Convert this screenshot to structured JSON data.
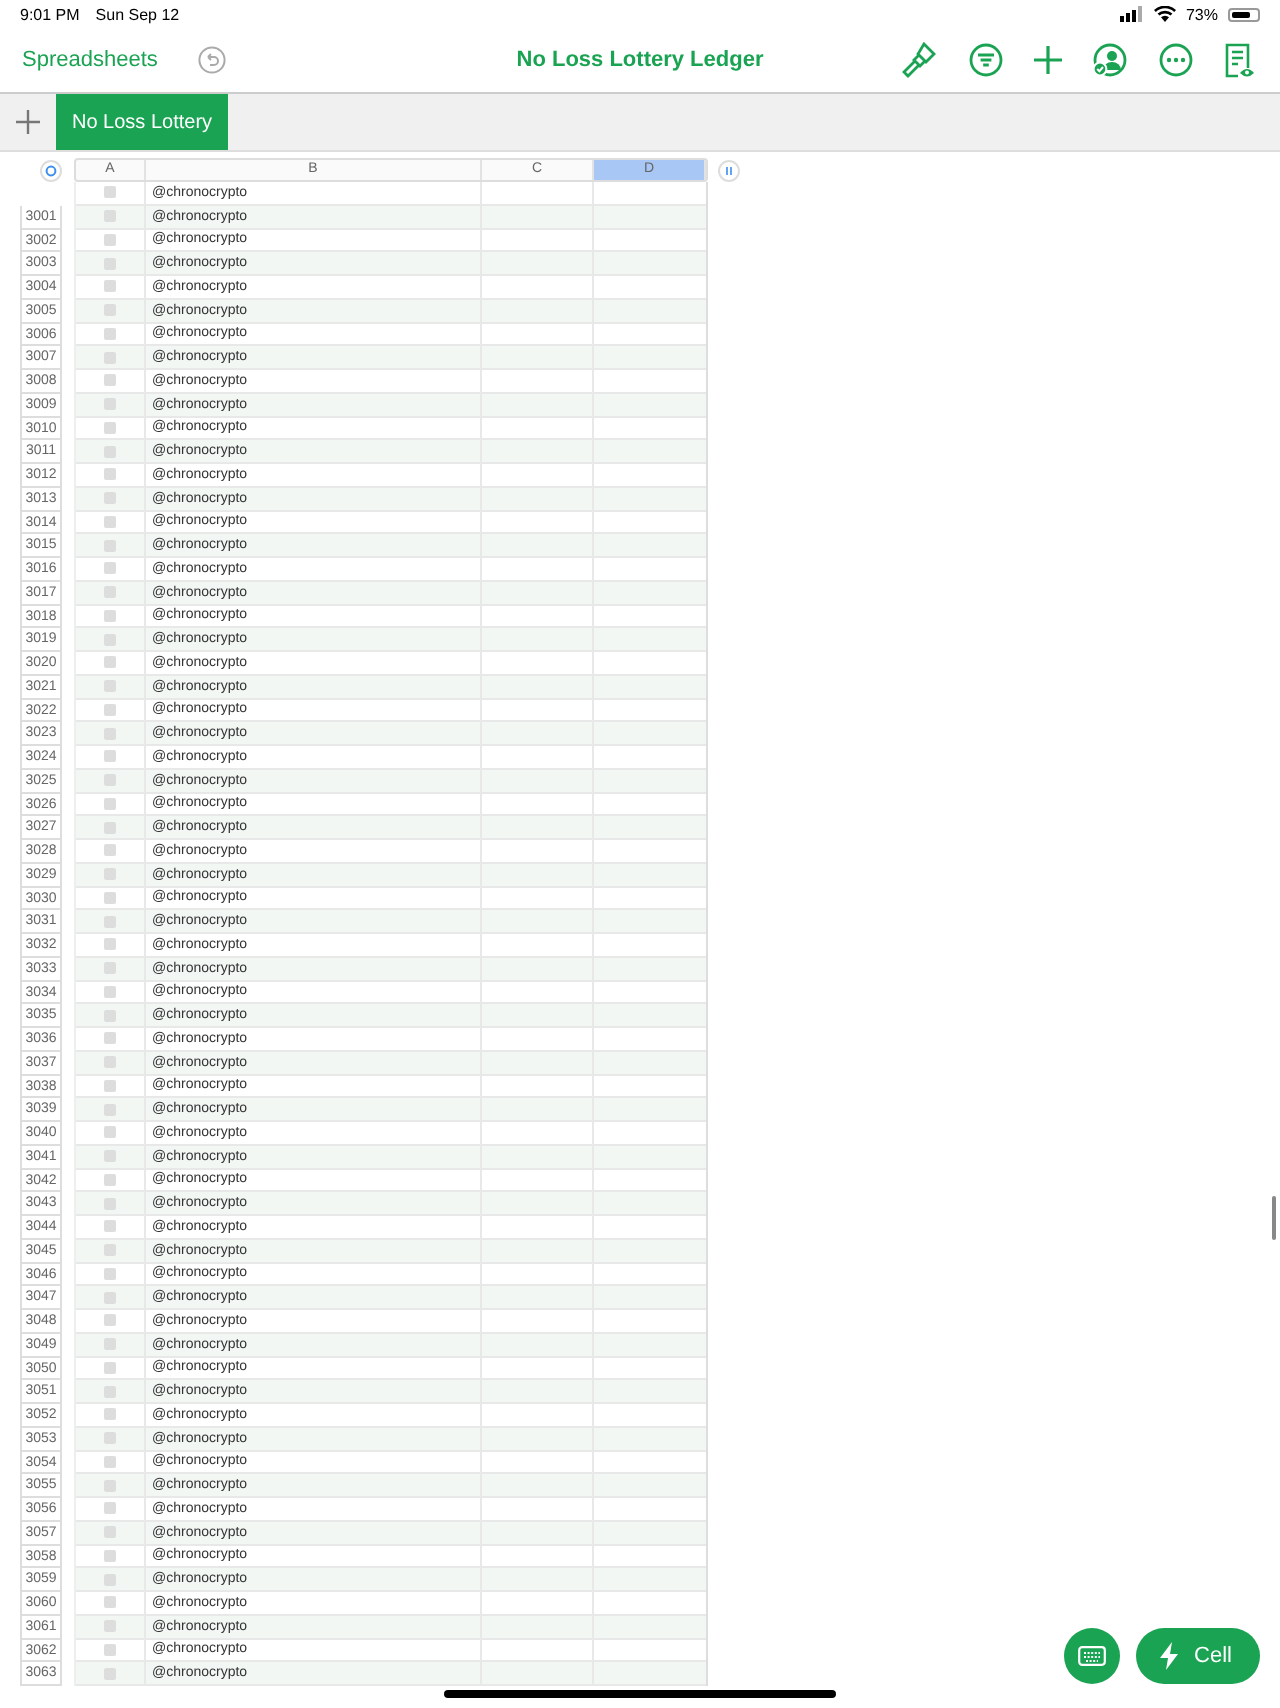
{
  "status_bar": {
    "time": "9:01 PM",
    "date": "Sun Sep 12",
    "battery": "73%"
  },
  "toolbar": {
    "back": "Spreadsheets",
    "title": "No Loss Lottery Ledger"
  },
  "sheet_tabs": [
    {
      "label": "No Loss Lottery",
      "selected": true
    }
  ],
  "table": {
    "columns": [
      {
        "label": "A",
        "selected": false
      },
      {
        "label": "B",
        "selected": false
      },
      {
        "label": "C",
        "selected": false
      },
      {
        "label": "D",
        "selected": true
      }
    ],
    "rows": [
      {
        "b": "@chronocrypto",
        "checked": false
      },
      {
        "number": "3001",
        "b": "@chronocrypto",
        "checked": false
      },
      {
        "number": "3002",
        "b": "@chronocrypto",
        "checked": false
      },
      {
        "number": "3003",
        "b": "@chronocrypto",
        "checked": false
      },
      {
        "number": "3004",
        "b": "@chronocrypto",
        "checked": false
      },
      {
        "number": "3005",
        "b": "@chronocrypto",
        "checked": false
      },
      {
        "number": "3006",
        "b": "@chronocrypto",
        "checked": false
      },
      {
        "number": "3007",
        "b": "@chronocrypto",
        "checked": false
      },
      {
        "number": "3008",
        "b": "@chronocrypto",
        "checked": false
      },
      {
        "number": "3009",
        "b": "@chronocrypto",
        "checked": false
      },
      {
        "number": "3010",
        "b": "@chronocrypto",
        "checked": false
      },
      {
        "number": "3011",
        "b": "@chronocrypto",
        "checked": false
      },
      {
        "number": "3012",
        "b": "@chronocrypto",
        "checked": false
      },
      {
        "number": "3013",
        "b": "@chronocrypto",
        "checked": false
      },
      {
        "number": "3014",
        "b": "@chronocrypto",
        "checked": false
      },
      {
        "number": "3015",
        "b": "@chronocrypto",
        "checked": false
      },
      {
        "number": "3016",
        "b": "@chronocrypto",
        "checked": false
      },
      {
        "number": "3017",
        "b": "@chronocrypto",
        "checked": false
      },
      {
        "number": "3018",
        "b": "@chronocrypto",
        "checked": false
      },
      {
        "number": "3019",
        "b": "@chronocrypto",
        "checked": false
      },
      {
        "number": "3020",
        "b": "@chronocrypto",
        "checked": false
      },
      {
        "number": "3021",
        "b": "@chronocrypto",
        "checked": false
      },
      {
        "number": "3022",
        "b": "@chronocrypto",
        "checked": false
      },
      {
        "number": "3023",
        "b": "@chronocrypto",
        "checked": false
      },
      {
        "number": "3024",
        "b": "@chronocrypto",
        "checked": false
      },
      {
        "number": "3025",
        "b": "@chronocrypto",
        "checked": false
      },
      {
        "number": "3026",
        "b": "@chronocrypto",
        "checked": false
      },
      {
        "number": "3027",
        "b": "@chronocrypto",
        "checked": false
      },
      {
        "number": "3028",
        "b": "@chronocrypto",
        "checked": false
      },
      {
        "number": "3029",
        "b": "@chronocrypto",
        "checked": false
      },
      {
        "number": "3030",
        "b": "@chronocrypto",
        "checked": false
      },
      {
        "number": "3031",
        "b": "@chronocrypto",
        "checked": false
      },
      {
        "number": "3032",
        "b": "@chronocrypto",
        "checked": false
      },
      {
        "number": "3033",
        "b": "@chronocrypto",
        "checked": false
      },
      {
        "number": "3034",
        "b": "@chronocrypto",
        "checked": false
      },
      {
        "number": "3035",
        "b": "@chronocrypto",
        "checked": false
      },
      {
        "number": "3036",
        "b": "@chronocrypto",
        "checked": false
      },
      {
        "number": "3037",
        "b": "@chronocrypto",
        "checked": false
      },
      {
        "number": "3038",
        "b": "@chronocrypto",
        "checked": false
      },
      {
        "number": "3039",
        "b": "@chronocrypto",
        "checked": false
      },
      {
        "number": "3040",
        "b": "@chronocrypto",
        "checked": false
      },
      {
        "number": "3041",
        "b": "@chronocrypto",
        "checked": false
      },
      {
        "number": "3042",
        "b": "@chronocrypto",
        "checked": false
      },
      {
        "number": "3043",
        "b": "@chronocrypto",
        "checked": false
      },
      {
        "number": "3044",
        "b": "@chronocrypto",
        "checked": false
      },
      {
        "number": "3045",
        "b": "@chronocrypto",
        "checked": false
      },
      {
        "number": "3046",
        "b": "@chronocrypto",
        "checked": false
      },
      {
        "number": "3047",
        "b": "@chronocrypto",
        "checked": false
      },
      {
        "number": "3048",
        "b": "@chronocrypto",
        "checked": false
      },
      {
        "number": "3049",
        "b": "@chronocrypto",
        "checked": false
      },
      {
        "number": "3050",
        "b": "@chronocrypto",
        "checked": false
      },
      {
        "number": "3051",
        "b": "@chronocrypto",
        "checked": false
      },
      {
        "number": "3052",
        "b": "@chronocrypto",
        "checked": false
      },
      {
        "number": "3053",
        "b": "@chronocrypto",
        "checked": false
      },
      {
        "number": "3054",
        "b": "@chronocrypto",
        "checked": false
      },
      {
        "number": "3055",
        "b": "@chronocrypto",
        "checked": false
      },
      {
        "number": "3056",
        "b": "@chronocrypto",
        "checked": false
      },
      {
        "number": "3057",
        "b": "@chronocrypto",
        "checked": false
      },
      {
        "number": "3058",
        "b": "@chronocrypto",
        "checked": false
      },
      {
        "number": "3059",
        "b": "@chronocrypto",
        "checked": false
      },
      {
        "number": "3060",
        "b": "@chronocrypto",
        "checked": false
      },
      {
        "number": "3061",
        "b": "@chronocrypto",
        "checked": false
      },
      {
        "number": "3062",
        "b": "@chronocrypto",
        "checked": false
      },
      {
        "number": "3063",
        "b": "@chronocrypto",
        "checked": false
      }
    ]
  },
  "cell_button": {
    "label": "Cell"
  }
}
